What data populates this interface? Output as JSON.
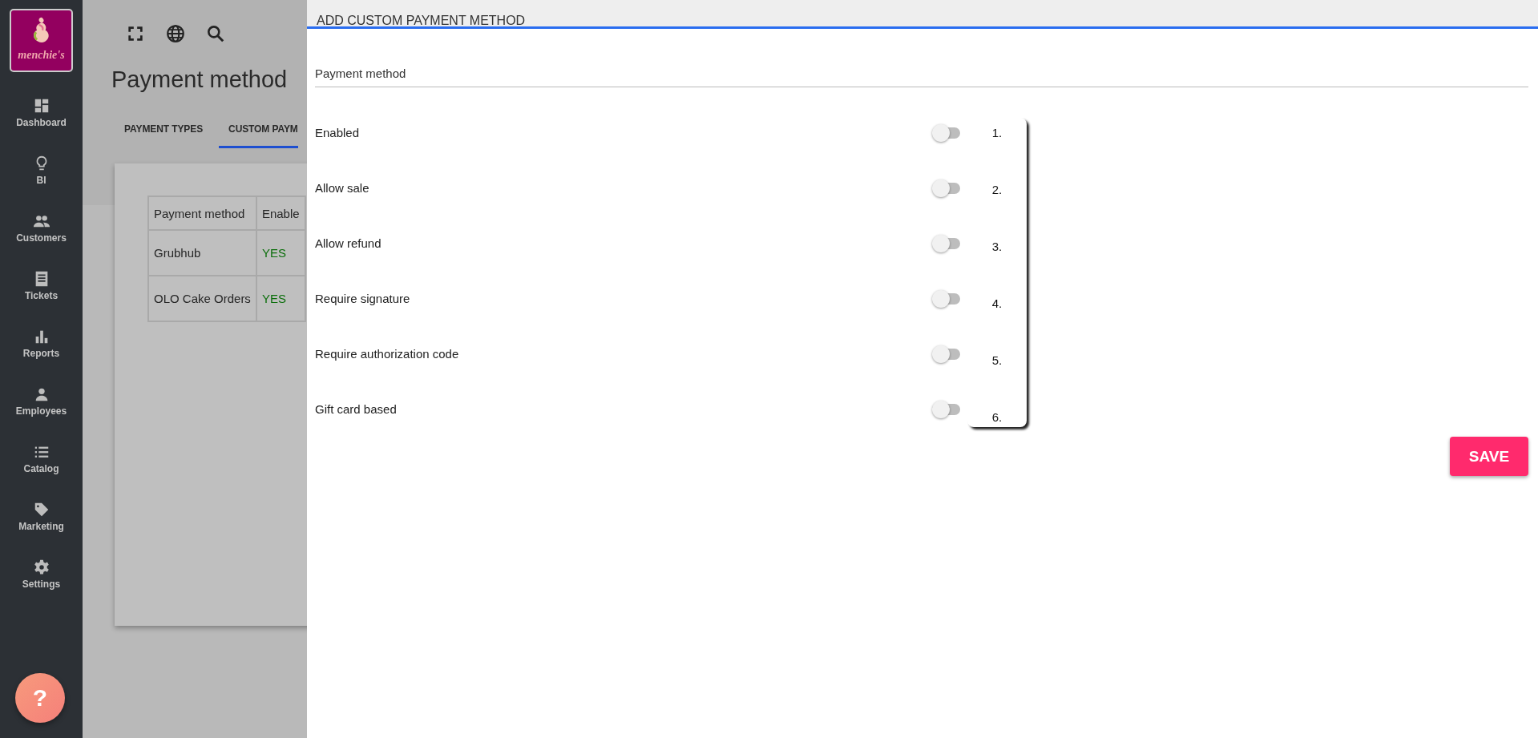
{
  "sidebar": {
    "logo": {
      "text": "menchie's"
    },
    "items": [
      {
        "label": "Dashboard",
        "kind": "dashboard"
      },
      {
        "label": "BI",
        "kind": "bulb"
      },
      {
        "label": "Customers",
        "kind": "people"
      },
      {
        "label": "Tickets",
        "kind": "receipt"
      },
      {
        "label": "Reports",
        "kind": "bars"
      },
      {
        "label": "Employees",
        "kind": "person"
      },
      {
        "label": "Catalog",
        "kind": "list"
      },
      {
        "label": "Marketing",
        "kind": "tag"
      },
      {
        "label": "Settings",
        "kind": "gear"
      }
    ],
    "help_button": "?"
  },
  "page": {
    "title": "Payment method",
    "tabs": [
      {
        "label": "PAYMENT TYPES",
        "selected": false
      },
      {
        "label": "CUSTOM PAYM",
        "selected": true
      }
    ],
    "table": {
      "columns": [
        "Payment method",
        "Enable"
      ],
      "rows": [
        [
          "Grubhub",
          "YES"
        ],
        [
          "OLO Cake Orders",
          "YES"
        ]
      ]
    }
  },
  "drawer": {
    "title": "ADD CUSTOM PAYMENT METHOD",
    "field": {
      "placeholder": "Payment method"
    },
    "switches": [
      {
        "label": "Enabled",
        "on": false
      },
      {
        "label": "Allow sale",
        "on": false
      },
      {
        "label": "Allow refund",
        "on": false
      },
      {
        "label": "Require signature",
        "on": false
      },
      {
        "label": "Require authorization code",
        "on": false
      },
      {
        "label": "Gift card based",
        "on": false
      }
    ],
    "numbers": [
      "1.",
      "2.",
      "3.",
      "4.",
      "5.",
      "6."
    ],
    "save_button": "SAVE"
  }
}
